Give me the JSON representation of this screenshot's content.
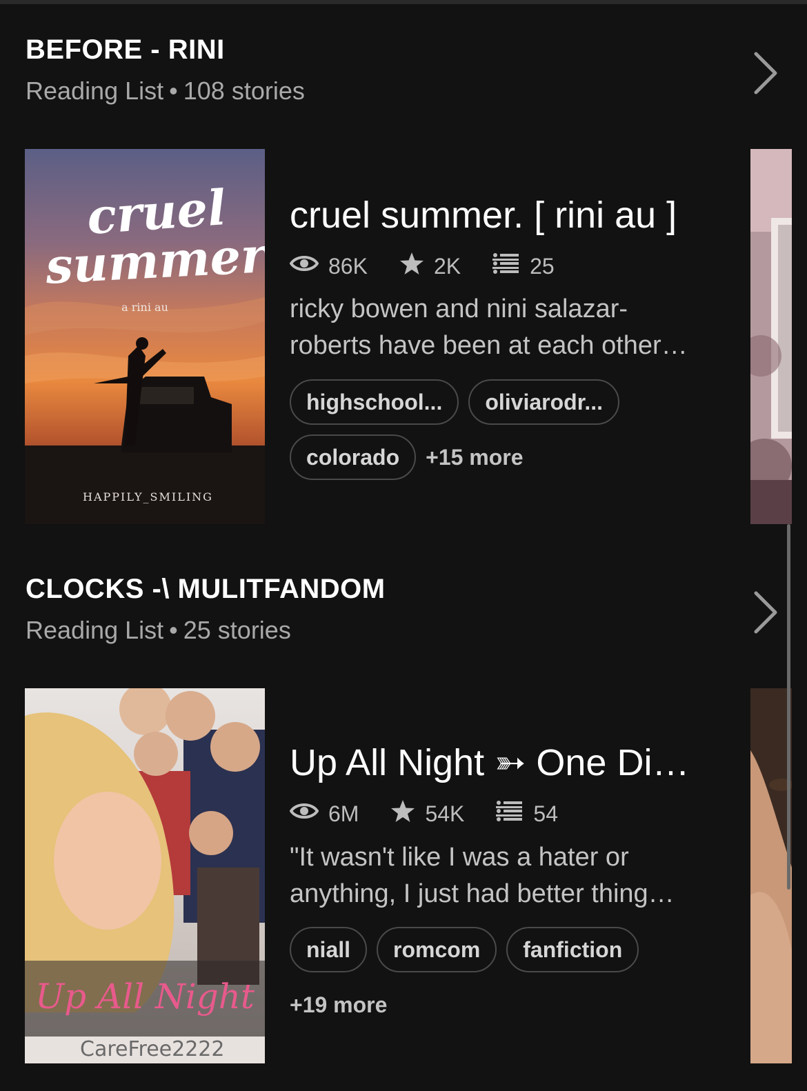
{
  "colors": {
    "background": "#121212",
    "muted_text": "#a9a9a9",
    "tag_border": "#4a4a4a",
    "cover2_title": "#e85a8c"
  },
  "lists": [
    {
      "title": "BEFORE - RINI",
      "type": "Reading List",
      "count": "108 stories",
      "chevron_icon": "chevron-right-icon",
      "story": {
        "title": "cruel summer. [ rini au ]",
        "reads": "86K",
        "votes": "2K",
        "parts": "25",
        "description_line1": "ricky bowen and nini salazar-",
        "description_line2": "roberts have been at each other…",
        "tags": [
          "highschool...",
          "oliviarodr...",
          "colorado"
        ],
        "more": "+15 more",
        "cover": {
          "title_line1": "cruel",
          "title_line2": "summer.",
          "subtitle": "a rini au",
          "author": "HAPPILY_SMILING"
        }
      }
    },
    {
      "title": "CLOCKS -\\ MULITFANDOM",
      "type": "Reading List",
      "count": "25 stories",
      "chevron_icon": "chevron-right-icon",
      "story": {
        "title": "Up All Night ➳ One Di…",
        "reads": "6M",
        "votes": "54K",
        "parts": "54",
        "description_line1": "\"It wasn't like I was a hater or",
        "description_line2": "anything, I just had better thing…",
        "tags": [
          "niall",
          "romcom",
          "fanfiction"
        ],
        "more": "+19 more",
        "cover": {
          "title_line1": "Up All Night",
          "author": "CareFree2222"
        }
      }
    }
  ],
  "dot": "•"
}
